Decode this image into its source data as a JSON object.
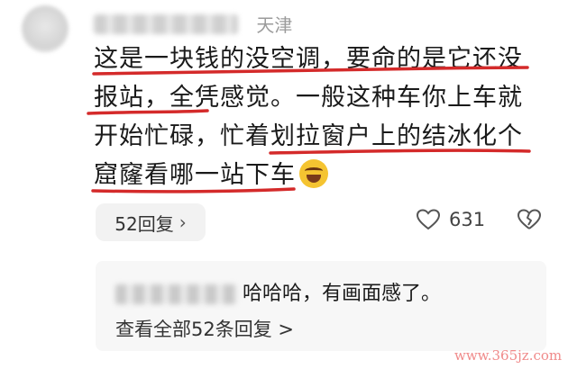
{
  "comment": {
    "location": "天津",
    "lines": [
      "这是一块钱的没空调，要命的是它还没",
      "报站，全凭感觉。一般这种车你上车就",
      "开始忙碌，忙着划拉窗户上的结冰化个",
      "窟窿看哪一站下车"
    ],
    "emoji_icon": "laughing-crying-emoji-icon",
    "reply_button": "52回复",
    "like_count": "631"
  },
  "sub_reply": {
    "text": "哈哈哈，有画面感了。",
    "view_all": "查看全部52条回复 >"
  },
  "watermark": "www.365jz.com",
  "colors": {
    "underline": "#d42a2a",
    "text": "#1a1a1a",
    "muted": "#9b9b9b",
    "panel": "#f7f7f7"
  }
}
